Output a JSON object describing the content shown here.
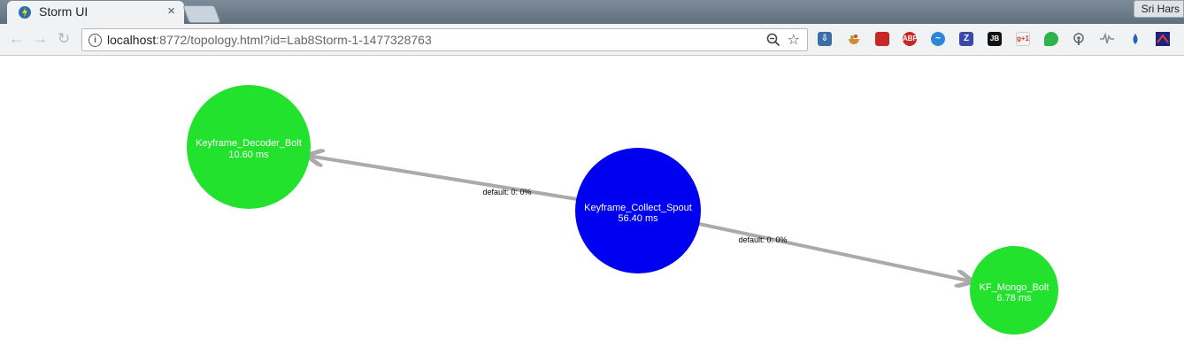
{
  "browser": {
    "tab_title": "Storm UI",
    "tab_close": "×",
    "user_name": "Sri Hars",
    "url_host": "localhost",
    "url_rest": ":8772/topology.html?id=Lab8Storm-1-1477328763",
    "extensions": [
      "download-icon",
      "bowl-icon",
      "red-book-icon",
      "abp-icon",
      "pulse-icon",
      "z-icon",
      "jb-icon",
      "gplus-icon",
      "evernote-icon",
      "podcast-icon",
      "waveform-icon",
      "drop-icon",
      "flag-icon"
    ],
    "extension_labels": {
      "abp": "ABP",
      "z": "Z",
      "jb": "JB",
      "gplus": "g+1"
    }
  },
  "topology": {
    "nodes": [
      {
        "id": "decoder",
        "name": "Keyframe_Decoder_Bolt",
        "latency": "10.60 ms",
        "color": "#22e22e"
      },
      {
        "id": "spout",
        "name": "Keyframe_Collect_Spout",
        "latency": "56.40 ms",
        "color": "#0000f0"
      },
      {
        "id": "mongo",
        "name": "KF_Mongo_Bolt",
        "latency": "6.78 ms",
        "color": "#22e22e"
      }
    ],
    "edges": [
      {
        "from": "spout",
        "to": "decoder",
        "label": "default: 0: 0%"
      },
      {
        "from": "spout",
        "to": "mongo",
        "label": "default: 0: 0%"
      }
    ],
    "edge_color": "#aaaaaa"
  }
}
